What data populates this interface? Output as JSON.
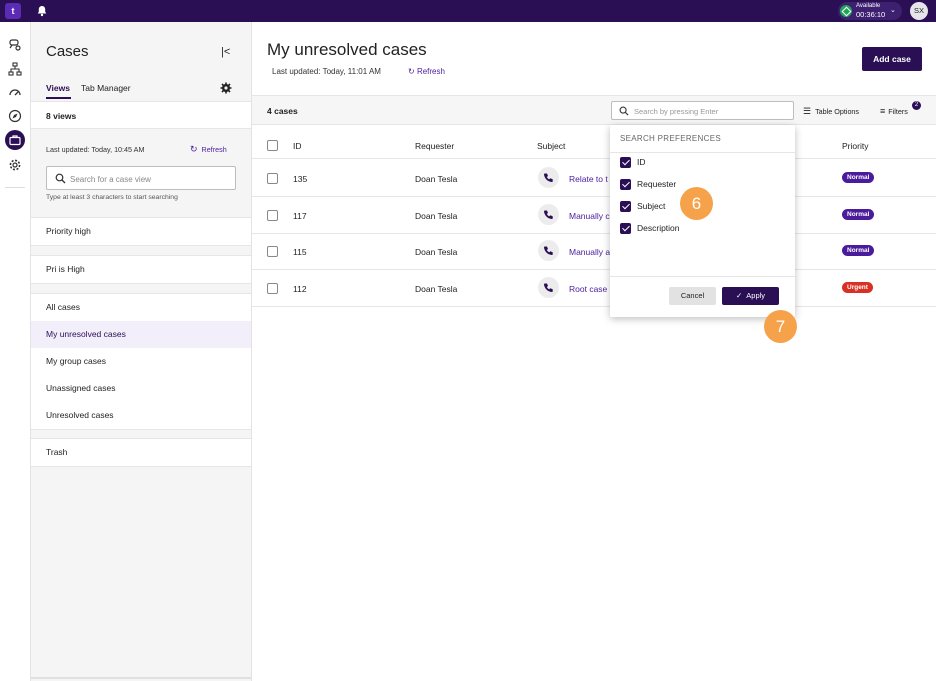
{
  "topbar": {
    "logo": "t",
    "status": {
      "label": "Available",
      "time": "00:36:10"
    },
    "avatar": "SX"
  },
  "sidebar": {
    "title": "Cases",
    "tabs": [
      "Views",
      "Tab Manager"
    ],
    "views_count": "8 views",
    "last_updated": "Last updated:  Today, 10:45 AM",
    "refresh": "Refresh",
    "search_placeholder": "Search for a case view",
    "search_hint": "Type at least 3 characters to start searching",
    "groups": [
      {
        "items": [
          "Priority high"
        ]
      },
      {
        "items": [
          "Pri is High"
        ]
      },
      {
        "items": [
          "All cases",
          "My unresolved cases",
          "My group cases",
          "Unassigned cases",
          "Unresolved cases"
        ],
        "selected": 1
      },
      {
        "items": [
          "Trash"
        ]
      }
    ]
  },
  "main": {
    "title": "My unresolved cases",
    "last_updated": "Last updated:  Today, 11:01 AM",
    "refresh": "Refresh",
    "add_case": "Add case",
    "count": "4 cases",
    "search_placeholder": "Search by pressing Enter",
    "table_options": "Table Options",
    "filters": "Filters",
    "filters_badge": "2",
    "columns": [
      "ID",
      "Requester",
      "Subject",
      "Priority"
    ],
    "rows": [
      {
        "id": "135",
        "requester": "Doan Tesla",
        "subject": "Relate to t",
        "priority": "Normal"
      },
      {
        "id": "117",
        "requester": "Doan Tesla",
        "subject": "Manually c",
        "priority": "Normal"
      },
      {
        "id": "115",
        "requester": "Doan Tesla",
        "subject": "Manually a",
        "priority": "Normal"
      },
      {
        "id": "112",
        "requester": "Doan Tesla",
        "subject": "Root case",
        "priority": "Urgent"
      }
    ]
  },
  "popup": {
    "heading": "SEARCH PREFERENCES",
    "options": [
      "ID",
      "Requester",
      "Subject",
      "Description"
    ],
    "cancel": "Cancel",
    "apply": "Apply"
  },
  "markers": [
    "6",
    "7"
  ],
  "colors": {
    "brand": "#2b0f55",
    "accent": "#4a1c9c",
    "normal": "#4a1c9c",
    "urgent": "#d93025",
    "marker": "#f5a24a"
  }
}
